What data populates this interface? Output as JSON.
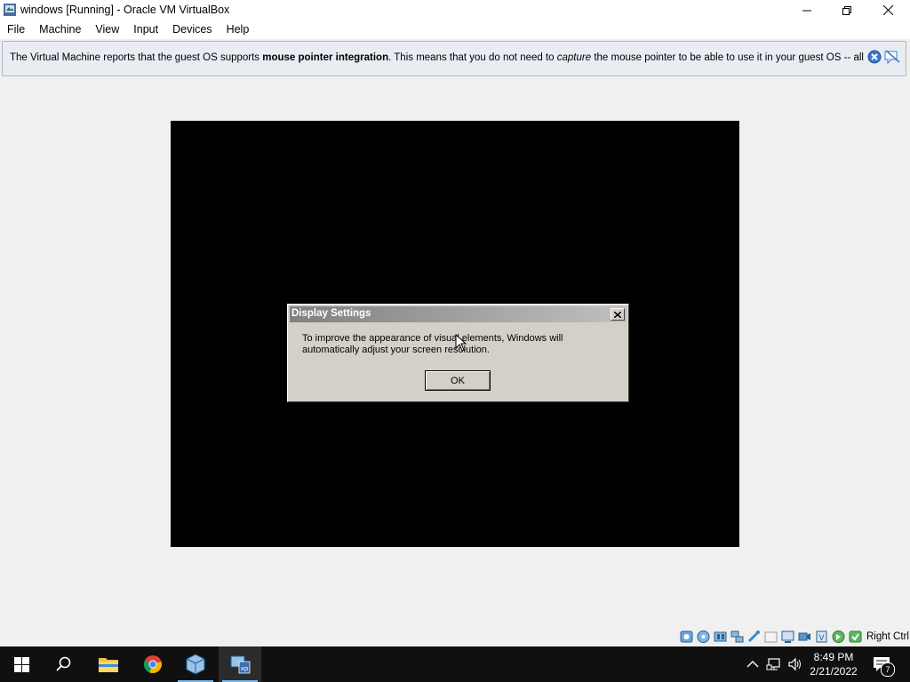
{
  "window": {
    "title": "windows [Running] - Oracle VM VirtualBox"
  },
  "menu": {
    "items": [
      {
        "label": "File"
      },
      {
        "label": "Machine"
      },
      {
        "label": "View"
      },
      {
        "label": "Input"
      },
      {
        "label": "Devices"
      },
      {
        "label": "Help"
      }
    ]
  },
  "notification": {
    "text_1": "The Virtual Machine reports that the guest OS supports ",
    "bold": "mouse pointer integration",
    "text_2": ". This means that you do not need to ",
    "italic": "capture",
    "text_3": " the mouse pointer to be able to use it in your guest OS -- all mouse"
  },
  "dialog": {
    "title": "Display Settings",
    "message": "To improve the appearance of visual elements, Windows will automatically adjust your screen resolution.",
    "ok_label": "OK"
  },
  "statusbar": {
    "icons": [
      "hard-disk-icon",
      "optical-drive-icon",
      "audio-icon",
      "network-icon",
      "usb-icon",
      "shared-folders-icon",
      "display-icon",
      "video-capture-icon",
      "cpu-icon",
      "mouse-integration-icon"
    ],
    "host_key": "Right Ctrl"
  },
  "taskbar": {
    "apps": [
      "start-icon",
      "search-icon",
      "file-explorer-icon",
      "chrome-icon",
      "virtualbox-icon",
      "virtualbox-vm-icon"
    ],
    "time": "8:49 PM",
    "date": "2/21/2022",
    "notification_count": "7"
  }
}
